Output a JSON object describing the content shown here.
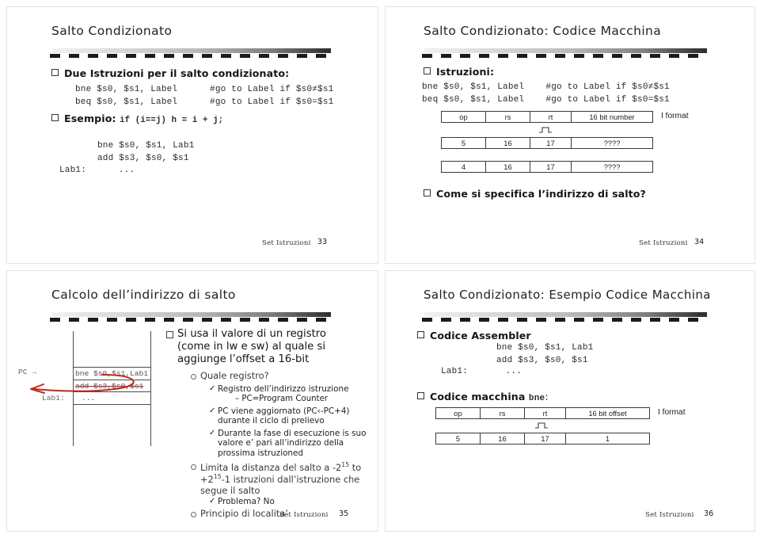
{
  "document": {
    "kind": "lecture-handout",
    "footer_label": "Set Istruzioni"
  },
  "slides": [
    {
      "number": "33",
      "title": "Salto Condizionato",
      "footer_label": "Set Istruzioni",
      "bullets": [
        {
          "text": "Due Istruzioni per il salto condizionato:"
        }
      ],
      "code_blocks": [
        {
          "lines": [
            "bne $s0, $s1, Label      #go to Label if $s0≠$s1",
            "beq $s0, $s1, Label      #go to Label if $s0=$s1"
          ]
        },
        {
          "lines": [
            "bne $s0, $s1, Lab1",
            "add $s3, $s0, $s1"
          ]
        },
        {
          "lines": [
            "Lab1:      ..."
          ]
        }
      ],
      "esempio_label": "Esempio:",
      "esempio_code": "if (i==j) h = i + j;"
    },
    {
      "number": "34",
      "title": "Salto Condizionato: Codice Macchina",
      "footer_label": "Set Istruzioni",
      "bullets": [
        {
          "text": "Istruzioni:"
        },
        {
          "text": "Come si specifica l’indirizzo di salto?"
        }
      ],
      "code_lines": [
        "bne $s0, $s1, Label    #go to Label if $s0≠$s1",
        "beq $s0, $s1, Label    #go to Label if $s0=$s1"
      ],
      "format_label": "I  format",
      "format_rows": [
        {
          "op": "op",
          "rs": "rs",
          "rt": "rt",
          "imm": "16 bit number"
        },
        {
          "op": "5",
          "rs": "16",
          "rt": "17",
          "imm": "????"
        },
        {
          "op": "4",
          "rs": "16",
          "rt": "17",
          "imm": "????"
        }
      ]
    },
    {
      "number": "35",
      "title": "Calcolo dell’indirizzo di salto",
      "footer_label": "Set Istruzioni",
      "diagram": {
        "pc_label": "PC",
        "pc_arrow": "→",
        "rows": [
          {
            "text": "bne $s0,$s1,Lab1",
            "struck": false
          },
          {
            "text": "add $s3,$s0,$s1",
            "struck": true
          }
        ],
        "label_row": "Lab1:",
        "label_row_code": "...",
        "annotation_color": "#c0281e"
      },
      "outline": {
        "main": "Si usa il valore di un registro (come in lw e sw) al quale si aggiunge l’offset a 16-bit",
        "sub1": "Quale registro?",
        "checks1": [
          "Registro dell’indirizzo istruzione",
          "PC viene aggiornato (PC‹-PC+4) durante il ciclo di prelievo",
          "Durante la fase di esecuzione is suo valore e’ pari all’indirizzo della prossima istruzioned"
        ],
        "dash1": "–  PC=Program Counter",
        "sub2_pre": "Limita la distanza del salto a -2",
        "sub2_sup1": "15",
        "sub2_mid": " to +2",
        "sub2_sup2": "15",
        "sub2_post": "-1 istruzioni dall’istruzione che segue il salto",
        "check2": "Problema? No",
        "sub3": "Principio di localita’"
      }
    },
    {
      "number": "36",
      "title": "Salto Condizionato: Esempio Codice Macchina",
      "footer_label": "Set Istruzioni",
      "bullets": [
        {
          "text": "Codice Assembler"
        },
        {
          "text": "Codice macchina ",
          "suffix_code": "bne",
          "suffix_text": ":"
        }
      ],
      "assembler_lines": [
        "bne $s0, $s1, Lab1",
        "add $s3, $s0, $s1"
      ],
      "assembler_label_line": "Lab1:       ...",
      "format_label": "I  format",
      "format_rows": [
        {
          "op": "op",
          "rs": "rs",
          "rt": "rt",
          "imm": "16 bit offset"
        },
        {
          "op": "5",
          "rs": "16",
          "rt": "17",
          "imm": "1"
        }
      ]
    }
  ]
}
